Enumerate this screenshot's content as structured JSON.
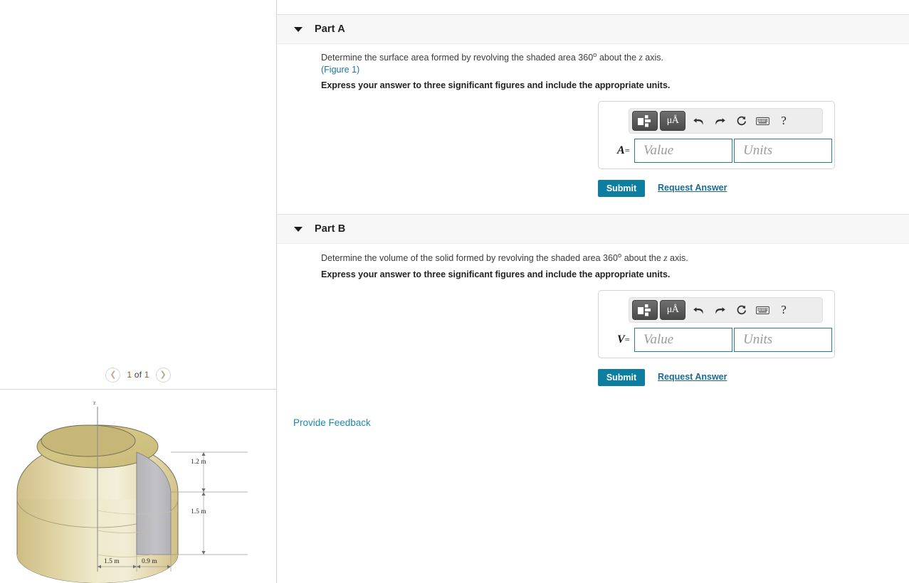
{
  "pager": {
    "prev_icon": "chevron-left-icon",
    "next_icon": "chevron-right-icon",
    "label_current": "1",
    "label_of": " of ",
    "label_total": "1",
    "full_label": "1 of 1"
  },
  "figure": {
    "axis_label": "z",
    "dim_top": "1.2 m",
    "dim_bottom": "1.5 m",
    "dim_inner_radius": "1.5 m",
    "dim_outer_width": "0.9 m",
    "colors": {
      "body_light": "#f2ecd2",
      "body_mid": "#ded3a4",
      "body_dark": "#cdbf82",
      "top_face": "#cbbc7c",
      "shaded_area": "#b9b9bd",
      "outline": "#6b6550"
    }
  },
  "parts": [
    {
      "id": "part-a",
      "title": "Part A",
      "caret_icon": "caret-down-icon",
      "question": "Determine the surface area formed by revolving the shaded area 360",
      "question_sup": "o",
      "question_tail": " about the ",
      "question_var": "z",
      "question_end": " axis.",
      "figure_link": "(Figure 1)",
      "instruction": "Express your answer to three significant figures and include the appropriate units.",
      "answer_label": "A",
      "answer_eq": "=",
      "value_placeholder": "Value",
      "units_placeholder": "Units",
      "value_current": "",
      "units_current": "",
      "submit_label": "Submit",
      "request_label": "Request Answer",
      "toolbar": {
        "template_icon": "math-template-icon",
        "units_icon": "μÅ",
        "undo_icon": "undo-arrow-icon",
        "redo_icon": "redo-arrow-icon",
        "reset_icon": "reset-circular-arrow-icon",
        "keyboard_icon": "keyboard-icon",
        "help_icon": "?"
      }
    },
    {
      "id": "part-b",
      "title": "Part B",
      "caret_icon": "caret-down-icon",
      "question": "Determine the volume of the solid formed by revolving the shaded area 360",
      "question_sup": "o",
      "question_tail": " about the ",
      "question_var": "z",
      "question_end": " axis.",
      "figure_link": "",
      "instruction": "Express your answer to three significant figures and include the appropriate units.",
      "answer_label": "V",
      "answer_eq": "=",
      "value_placeholder": "Value",
      "units_placeholder": "Units",
      "value_current": "",
      "units_current": "",
      "submit_label": "Submit",
      "request_label": "Request Answer",
      "toolbar": {
        "template_icon": "math-template-icon",
        "units_icon": "μÅ",
        "undo_icon": "undo-arrow-icon",
        "redo_icon": "redo-arrow-icon",
        "reset_icon": "reset-circular-arrow-icon",
        "keyboard_icon": "keyboard-icon",
        "help_icon": "?"
      }
    }
  ],
  "footer": {
    "feedback_label": "Provide Feedback"
  },
  "theme": {
    "accent_teal": "#0d7ea0",
    "link_blue": "#1a75a7",
    "header_bg": "#f7f7f7",
    "input_border": "#2a7a90"
  }
}
